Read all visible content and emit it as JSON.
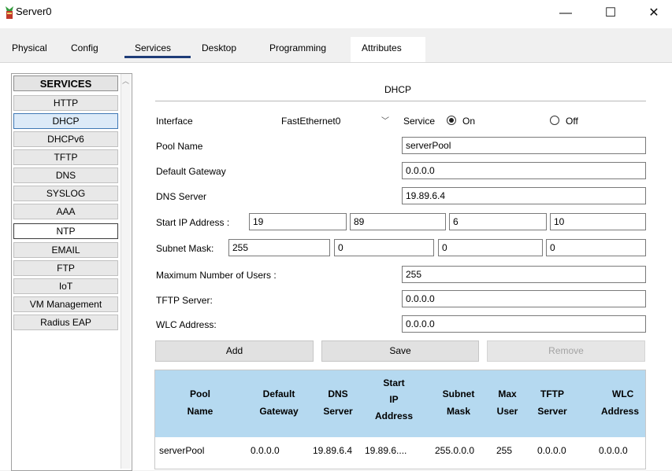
{
  "window": {
    "title": "Server0",
    "minimize": "—",
    "maximize": "☐",
    "close": "✕"
  },
  "tabs": [
    "Physical",
    "Config",
    "Services",
    "Desktop",
    "Programming",
    "Attributes"
  ],
  "services": {
    "header": "SERVICES",
    "items": [
      "HTTP",
      "DHCP",
      "DHCPv6",
      "TFTP",
      "DNS",
      "SYSLOG",
      "AAA",
      "NTP",
      "EMAIL",
      "FTP",
      "IoT",
      "VM Management",
      "Radius EAP"
    ]
  },
  "dhcp": {
    "title": "DHCP",
    "interface_label": "Interface",
    "interface_value": "FastEthernet0",
    "service_label": "Service",
    "on_label": "On",
    "off_label": "Off",
    "pool_name_label": "Pool Name",
    "pool_name_value": "serverPool",
    "gateway_label": "Default Gateway",
    "gateway_value": "0.0.0.0",
    "dns_label": "DNS Server",
    "dns_value": "19.89.6.4",
    "start_ip_label": "Start IP Address :",
    "start_ip": [
      "19",
      "89",
      "6",
      "10"
    ],
    "subnet_label": "Subnet Mask:",
    "subnet": [
      "255",
      "0",
      "0",
      "0"
    ],
    "max_users_label": "Maximum Number of Users :",
    "max_users_value": "255",
    "tftp_label": "TFTP Server:",
    "tftp_value": "0.0.0.0",
    "wlc_label": "WLC Address:",
    "wlc_value": "0.0.0.0",
    "buttons": {
      "add": "Add",
      "save": "Save",
      "remove": "Remove"
    },
    "table": {
      "headers": [
        [
          "Pool",
          "Name"
        ],
        [
          "Default",
          "Gateway"
        ],
        [
          "DNS",
          "Server"
        ],
        [
          "Start",
          "IP",
          "Address"
        ],
        [
          "Subnet",
          "Mask"
        ],
        [
          "Max",
          "User"
        ],
        [
          "TFTP",
          "Server"
        ],
        [
          "WLC",
          "Address"
        ]
      ],
      "rows": [
        [
          "serverPool",
          "0.0.0.0",
          "19.89.6.4",
          "19.89.6....",
          "255.0.0.0",
          "255",
          "0.0.0.0",
          "0.0.0.0"
        ]
      ]
    }
  }
}
